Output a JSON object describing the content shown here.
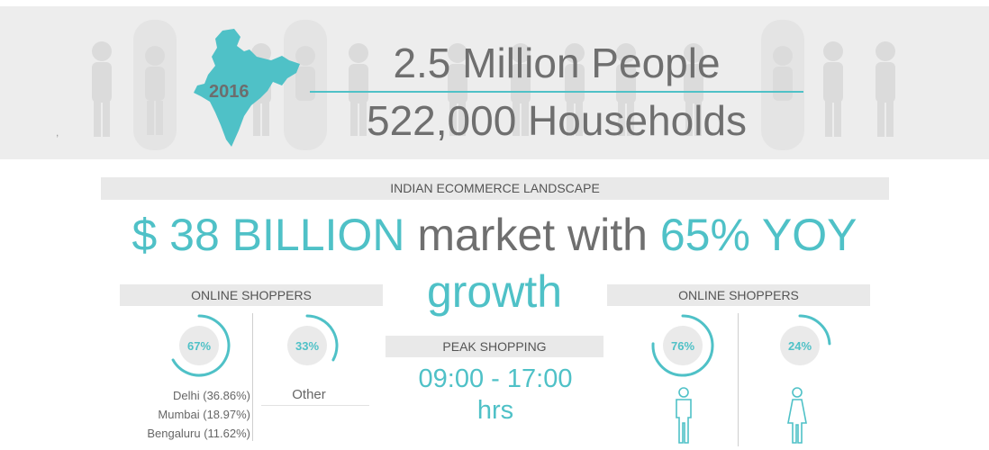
{
  "banner": {
    "year": "2016",
    "headline_people": "2.5 Million People",
    "headline_households": "522,000 Households"
  },
  "section": {
    "title": "INDIAN ECOMMERCE LANDSCAPE"
  },
  "market": {
    "value_text": "$ 38 BILLION",
    "middle_text": "market with",
    "growth_text": "65% YOY",
    "growth_word": "growth"
  },
  "online_shoppers_city": {
    "title": "ONLINE SHOPPERS",
    "metro_percent_label": "67%",
    "metro_fraction": 0.67,
    "other_percent_label": "33%",
    "other_fraction": 0.33,
    "cities": [
      "Delhi (36.86%)",
      "Mumbai (18.97%)",
      "Bengaluru (11.62%)"
    ],
    "other_label": "Other"
  },
  "peak_shopping": {
    "title": "PEAK SHOPPING",
    "time_range": "09:00 - 17:00",
    "unit": "hrs"
  },
  "online_shoppers_gender": {
    "title": "ONLINE SHOPPERS",
    "male_percent_label": "76%",
    "male_fraction": 0.76,
    "female_percent_label": "24%",
    "female_fraction": 0.24
  },
  "colors": {
    "accent": "#4fc1c7",
    "text": "#6f6f6f",
    "bar_bg": "#e9e9e9",
    "circle_bg": "#eaeaea"
  },
  "icons": [
    "india-map-icon",
    "male-icon",
    "female-icon"
  ]
}
